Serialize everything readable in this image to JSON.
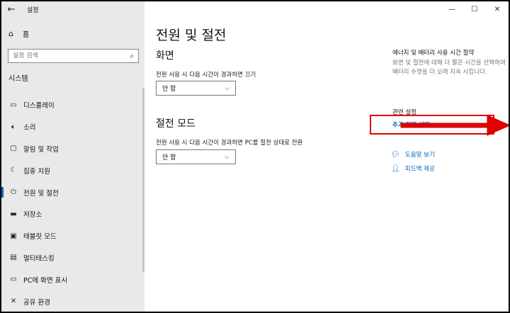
{
  "window": {
    "app_title": "설정",
    "back_icon": "←",
    "minimize_icon": "—",
    "maximize_icon": "☐",
    "close_icon": "✕"
  },
  "sidebar": {
    "home_label": "홈",
    "search_placeholder": "설정 검색",
    "section_label": "시스템",
    "items": [
      {
        "label": "디스플레이",
        "icon": "display-icon"
      },
      {
        "label": "소리",
        "icon": "speaker-icon"
      },
      {
        "label": "알림 및 작업",
        "icon": "notification-icon"
      },
      {
        "label": "집중 지원",
        "icon": "moon-icon"
      },
      {
        "label": "전원 및 절전",
        "icon": "power-icon",
        "active": true
      },
      {
        "label": "저장소",
        "icon": "storage-icon"
      },
      {
        "label": "태블릿 모드",
        "icon": "tablet-icon"
      },
      {
        "label": "멀티태스킹",
        "icon": "multitask-icon"
      },
      {
        "label": "PC에 화면 표시",
        "icon": "project-icon"
      },
      {
        "label": "공유 환경",
        "icon": "share-icon"
      }
    ]
  },
  "main": {
    "page_title": "전원 및 절전",
    "screen": {
      "heading": "화면",
      "label": "전원 사용 시 다음 시간이 경과하면 끄기",
      "value": "안 함"
    },
    "sleep": {
      "heading": "절전 모드",
      "label": "전원 사용 시 다음 시간이 경과하면 PC를 절전 상태로 전환",
      "value": "안 함"
    }
  },
  "aside": {
    "tip_title": "에너지 및 배터리 사용 시간 절약",
    "tip_desc": "화면 및 절전에 대해 더 짧은 시간을 선택하여 배터리 수명을 더 오래 지속 시킵니다.",
    "related_heading": "관련 설정",
    "related_link": "추가 전원 설정",
    "help_link": "도움말 보기",
    "feedback_link": "피드백 제공"
  },
  "colors": {
    "accent": "#0067c0",
    "highlight": "#e30000"
  }
}
